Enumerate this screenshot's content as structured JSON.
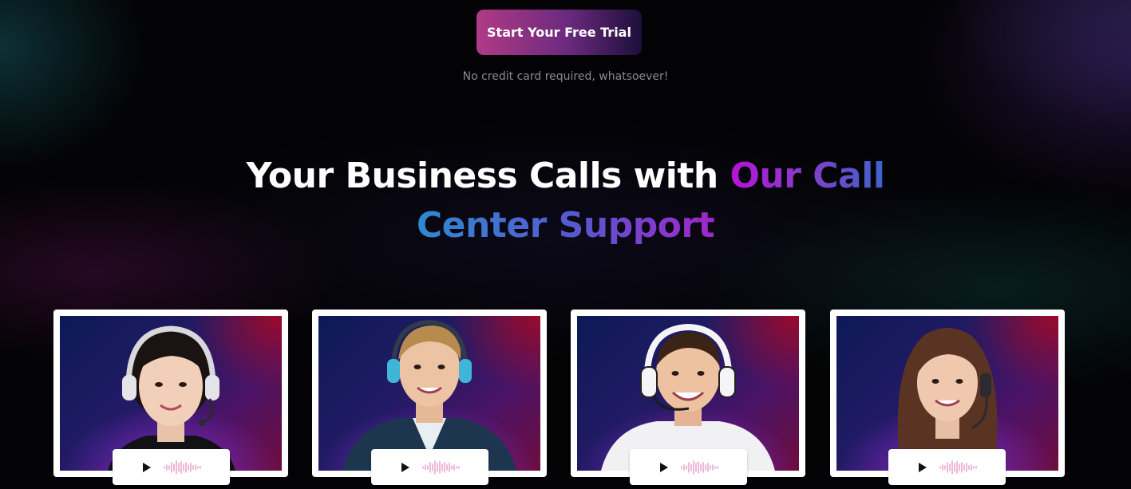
{
  "cta": {
    "label": "Start Your Free Trial"
  },
  "note": "No credit card required, whatsoever!",
  "headline": {
    "part1": "Your Business Calls with ",
    "part2": "Our Call",
    "part3": "Center Support"
  },
  "agents": [
    {
      "id": "agent-1",
      "icon": "play-icon"
    },
    {
      "id": "agent-2",
      "icon": "play-icon"
    },
    {
      "id": "agent-3",
      "icon": "play-icon"
    },
    {
      "id": "agent-4",
      "icon": "play-icon"
    }
  ],
  "colors": {
    "cta_start": "#b03a86",
    "cta_end": "#1c0f3a",
    "accent_purple": "#b513d9",
    "accent_blue": "#2e8ad1",
    "waveform": "#e79bc8"
  }
}
